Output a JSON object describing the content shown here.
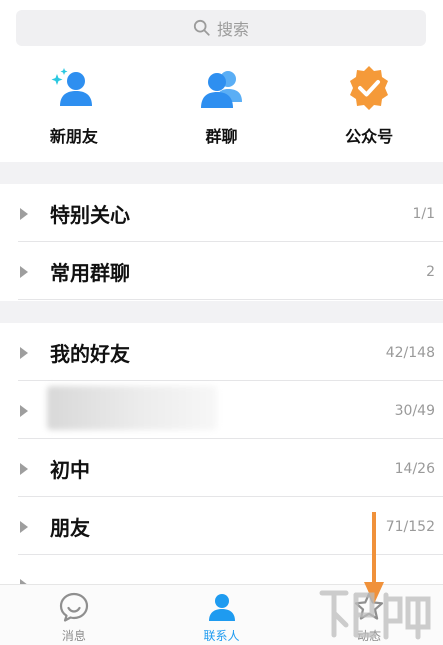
{
  "search": {
    "placeholder": "搜索",
    "icon": "search-icon"
  },
  "quick_actions": [
    {
      "label": "新朋友",
      "icon": "new-friend-icon"
    },
    {
      "label": "群聊",
      "icon": "group-chat-icon"
    },
    {
      "label": "公众号",
      "icon": "official-account-icon"
    }
  ],
  "groups": [
    {
      "name": "特别关心",
      "count": "1/1"
    },
    {
      "name": "常用群聊",
      "count": "2"
    },
    {
      "name": "我的好友",
      "count": "42/148"
    },
    {
      "name": "",
      "count": "30/49"
    },
    {
      "name": "初中",
      "count": "14/26"
    },
    {
      "name": "朋友",
      "count": "71/152"
    }
  ],
  "tabbar": {
    "tabs": [
      {
        "label": "消息",
        "icon": "message-icon"
      },
      {
        "label": "联系人",
        "icon": "contacts-icon"
      },
      {
        "label": "动态",
        "icon": "star-icon"
      }
    ]
  },
  "colors": {
    "accent": "#1e9bf0",
    "icon_blue": "#2e8ff0",
    "badge_orange": "#f59a39",
    "annotation_orange": "#f0913a"
  }
}
